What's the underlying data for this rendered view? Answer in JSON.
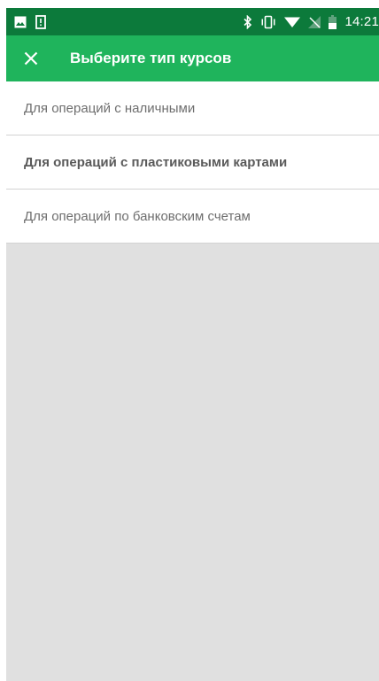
{
  "status_bar": {
    "time": "14:21",
    "icons": [
      "image-icon",
      "sim-alert-icon",
      "bluetooth-icon",
      "vibrate-icon",
      "wifi-icon",
      "no-signal-icon",
      "battery-icon"
    ]
  },
  "app_bar": {
    "title": "Выберите тип курсов",
    "close_icon": "close-icon"
  },
  "list": {
    "items": [
      {
        "label": "Для операций с наличными",
        "selected": false
      },
      {
        "label": "Для операций с пластиковыми картами",
        "selected": true
      },
      {
        "label": "Для операций по банковским счетам",
        "selected": false
      }
    ]
  },
  "colors": {
    "status_bar": "#0c7a3b",
    "app_bar": "#1fb45c",
    "background": "#e0e0e0"
  }
}
